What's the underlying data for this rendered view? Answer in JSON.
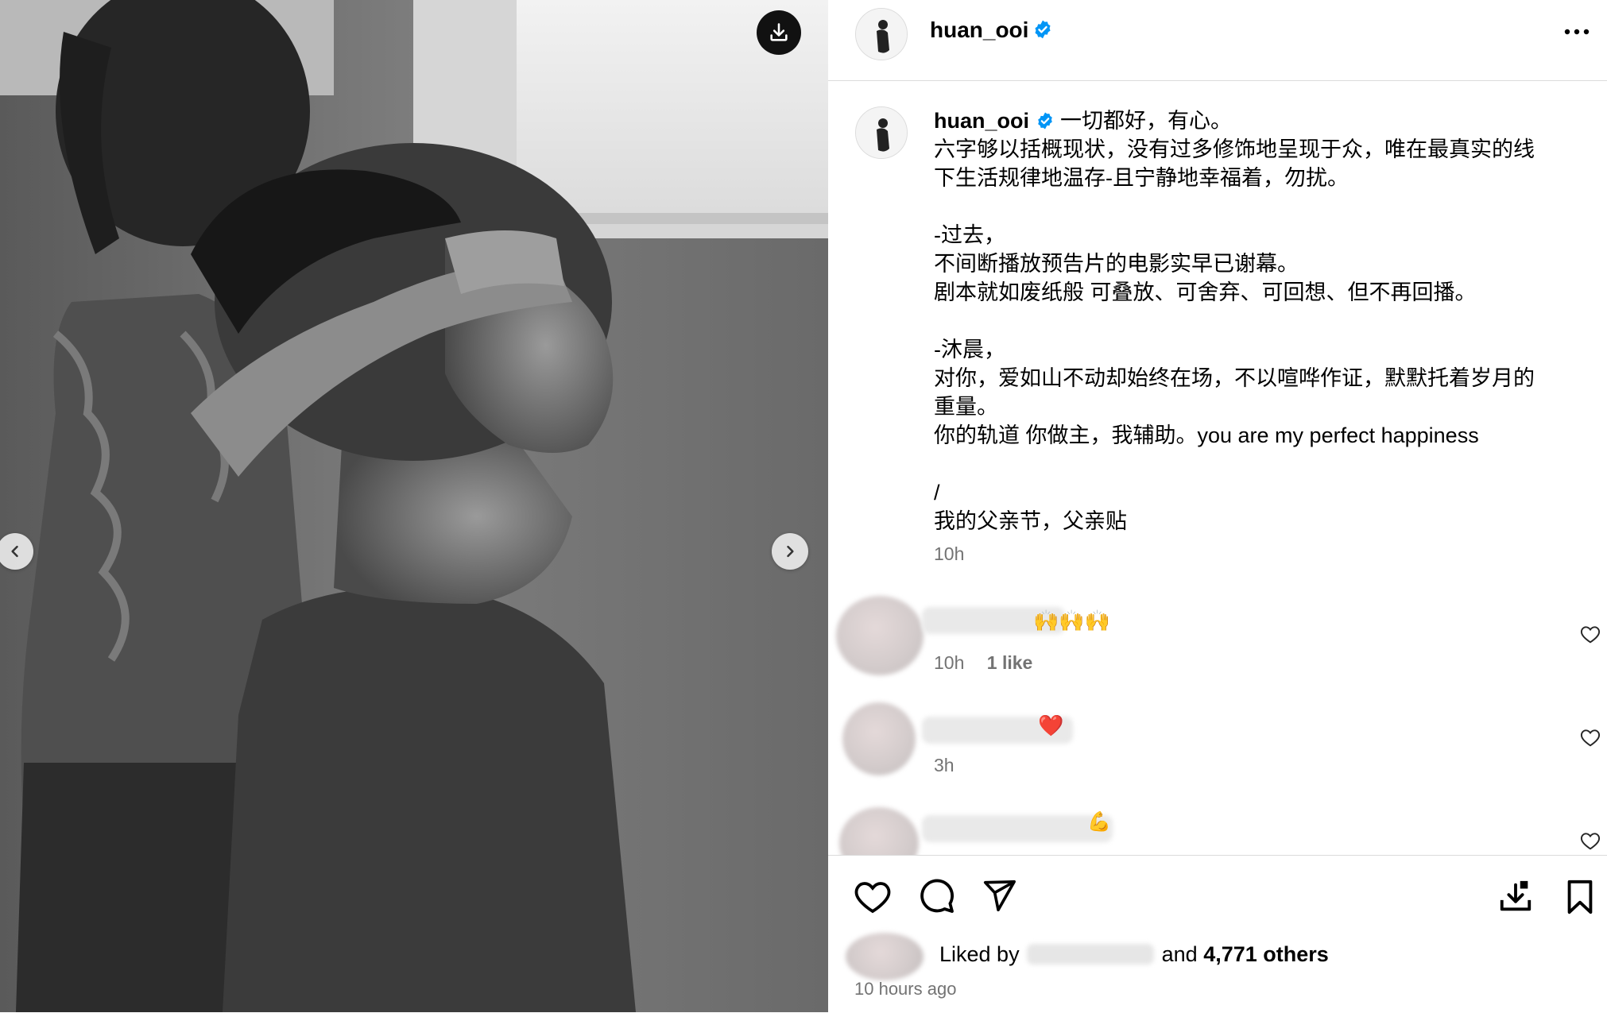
{
  "post": {
    "username": "huan_ooi",
    "verified": true,
    "caption_first_line": "一切都好，有心。",
    "caption_lines": [
      "六字够以括概现状，没有过多修饰地呈现于众，唯在最真实的线",
      "下生活规律地温存-且宁静地幸福着，勿扰。",
      "",
      "-过去，",
      "不间断播放预告片的电影实早已谢幕。",
      "剧本就如废纸般 可叠放、可舍弃、可回想、但不再回播。",
      "",
      "-沐晨，",
      "对你，爱如山不动却始终在场，不以喧哗作证，默默托着岁月的",
      "重量。",
      "你的轨道 你做主，我辅助。you are my perfect happiness",
      "",
      "/",
      "我的父亲节，父亲贴"
    ],
    "caption_time": "10h"
  },
  "comments": [
    {
      "emoji": "🙌🙌🙌",
      "time": "10h",
      "likes": "1 like"
    },
    {
      "emoji": "❤️",
      "time": "3h",
      "likes": ""
    },
    {
      "emoji": "💪",
      "time": "",
      "likes": ""
    }
  ],
  "footer": {
    "liked_prefix": "Liked by",
    "liked_and": "and",
    "liked_count": "4,771 others",
    "posted_ago": "10 hours ago"
  },
  "icons": {
    "download": "download-icon",
    "prev": "chevron-left-icon",
    "next": "chevron-right-icon",
    "more": "more-horizontal-icon",
    "like": "heart-icon",
    "comment": "comment-icon",
    "share": "send-icon",
    "save_media": "save-to-device-icon",
    "bookmark": "bookmark-icon"
  },
  "colors": {
    "verified_blue": "#0095f6",
    "heart_red": "#ed4956",
    "secondary_text": "#737373",
    "divider": "#dbdbdb"
  }
}
